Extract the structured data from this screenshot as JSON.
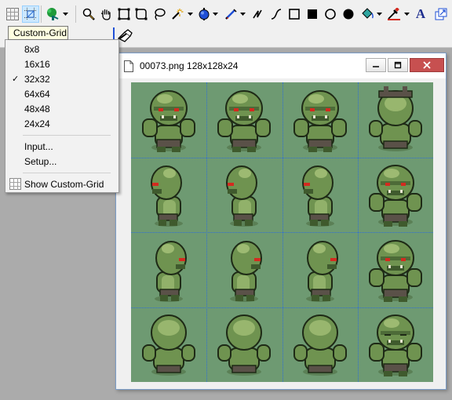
{
  "toolbar": {
    "tools": [
      {
        "icon": "grid-icon"
      },
      {
        "icon": "custom-grid-icon"
      },
      {
        "icon": "tree-icon"
      },
      {
        "icon": "zoom-icon"
      },
      {
        "icon": "hand-icon"
      },
      {
        "icon": "select-rect-icon"
      },
      {
        "icon": "select-rounded-icon"
      },
      {
        "icon": "lasso-icon"
      },
      {
        "icon": "magic-wand-icon"
      },
      {
        "icon": "color-replace-icon"
      },
      {
        "icon": "pen-icon"
      },
      {
        "icon": "line-icon"
      },
      {
        "icon": "curve-icon"
      },
      {
        "icon": "rectangle-icon"
      },
      {
        "icon": "filled-rectangle-icon"
      },
      {
        "icon": "ellipse-icon"
      },
      {
        "icon": "filled-ellipse-icon"
      },
      {
        "icon": "fill-icon"
      },
      {
        "icon": "color-picker-icon"
      },
      {
        "icon": "text-icon"
      },
      {
        "icon": "resize-icon"
      }
    ],
    "text_tool_glyph": "A"
  },
  "tooltip": "Custom-Grid",
  "menu": {
    "items": [
      {
        "label": "8x8",
        "checked": false
      },
      {
        "label": "16x16",
        "checked": false
      },
      {
        "label": "32x32",
        "checked": true
      },
      {
        "label": "64x64",
        "checked": false
      },
      {
        "label": "48x48",
        "checked": false
      },
      {
        "label": "24x24",
        "checked": false
      }
    ],
    "input_label": "Input...",
    "setup_label": "Setup...",
    "show_grid_label": "Show Custom-Grid",
    "check_mark": "✓"
  },
  "window": {
    "title": "00073.png 128x128x24"
  },
  "sprite_sheet": {
    "rows": 4,
    "cols": 4,
    "grid_cell": "32x32",
    "rows_desc": [
      [
        "front",
        "front",
        "front",
        "back-pack"
      ],
      [
        "side-left",
        "side-left",
        "side-left",
        "front"
      ],
      [
        "side-right",
        "side-right",
        "side-right",
        "front"
      ],
      [
        "back",
        "back",
        "back",
        "front-eyes-closed"
      ]
    ]
  },
  "colors": {
    "canvas_bg": "#6e9a72",
    "grid_line": "#2f6fd6",
    "orc_skin": "#6f9350",
    "orc_shadow": "#3f5a2d",
    "orc_highlight": "#a9c47b",
    "orc_eyes": "#d42a1f",
    "orc_pants": "#5a5148",
    "close_button": "#c75050"
  }
}
